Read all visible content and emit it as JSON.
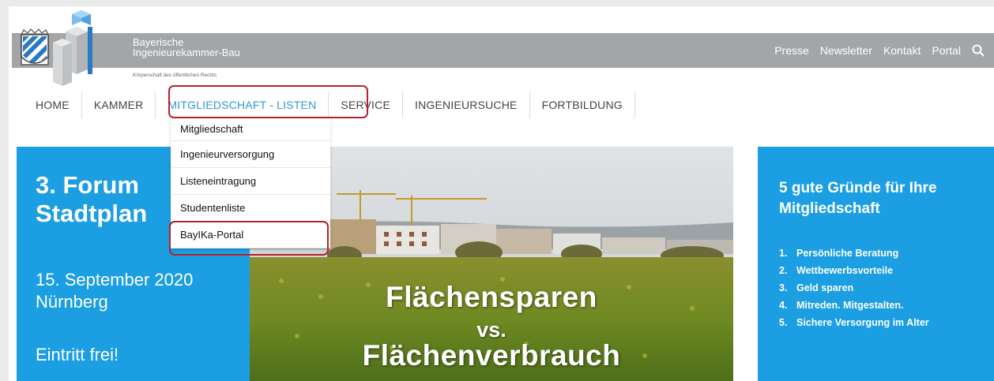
{
  "header": {
    "brand_line1": "Bayerische",
    "brand_line2": "Ingenieurekammer-Bau",
    "brand_subtitle": "Körperschaft des öffentlichen Rechts",
    "links": [
      "Presse",
      "Newsletter",
      "Kontakt",
      "Portal"
    ],
    "search_icon": "search-icon"
  },
  "nav": {
    "items": [
      "HOME",
      "KAMMER",
      "MITGLIEDSCHAFT - LISTEN",
      "SERVICE",
      "INGENIEURSUCHE",
      "FORTBILDUNG"
    ],
    "active_index": 2
  },
  "dropdown": {
    "items": [
      "Mitgliedschaft",
      "Ingenieurversorgung",
      "Listeneintragung",
      "Studentenliste",
      "BayIKa-Portal"
    ]
  },
  "left_panel": {
    "title": "3. Forum\nStadtplan",
    "date": "15. September 2020",
    "city": "Nürnberg",
    "entry": "Eintritt frei!"
  },
  "hero": {
    "line1": "Flächensparen",
    "line2": "vs.",
    "line3": "Flächenverbrauch"
  },
  "right_panel": {
    "title": "5 gute Gründe für Ihre Mitgliedschaft",
    "reasons": [
      {
        "num": "1.",
        "text": "Persönliche Beratung"
      },
      {
        "num": "2.",
        "text": "Wettbewerbsvorteile"
      },
      {
        "num": "3.",
        "text": "Geld sparen"
      },
      {
        "num": "4.",
        "text": "Mitreden. Mitgestalten."
      },
      {
        "num": "5.",
        "text": "Sichere Versorgung im Alter"
      }
    ]
  },
  "colors": {
    "accent_blue": "#1b9ee2",
    "nav_active": "#2f97d4",
    "header_gray": "#a3a5a7",
    "highlight_red": "#b5202a"
  }
}
